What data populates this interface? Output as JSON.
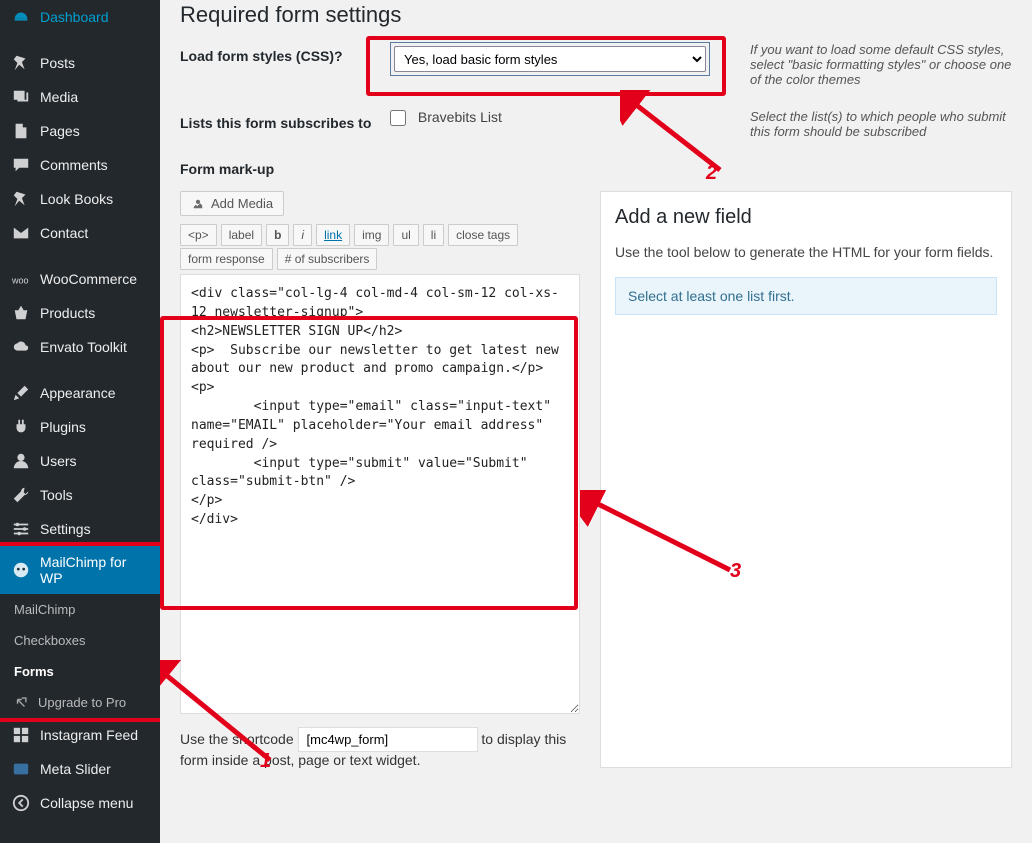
{
  "sidebar": {
    "items": [
      {
        "icon": "dashboard",
        "label": "Dashboard"
      },
      {
        "icon": "pin",
        "label": "Posts"
      },
      {
        "icon": "media",
        "label": "Media"
      },
      {
        "icon": "page",
        "label": "Pages"
      },
      {
        "icon": "comment",
        "label": "Comments"
      },
      {
        "icon": "pin",
        "label": "Look Books"
      },
      {
        "icon": "mail",
        "label": "Contact"
      },
      {
        "icon": "cart",
        "label": "WooCommerce"
      },
      {
        "icon": "basket",
        "label": "Products"
      },
      {
        "icon": "cloud",
        "label": "Envato Toolkit"
      },
      {
        "icon": "brush",
        "label": "Appearance"
      },
      {
        "icon": "plug",
        "label": "Plugins"
      },
      {
        "icon": "user",
        "label": "Users"
      },
      {
        "icon": "wrench",
        "label": "Tools"
      },
      {
        "icon": "sliders",
        "label": "Settings"
      },
      {
        "icon": "monkey",
        "label": "MailChimp for WP",
        "active": true
      },
      {
        "sub": true,
        "label": "MailChimp"
      },
      {
        "sub": true,
        "label": "Checkboxes"
      },
      {
        "sub": true,
        "label": "Forms",
        "activeSub": true
      },
      {
        "sub": true,
        "label": "Upgrade to Pro",
        "ext": true
      },
      {
        "icon": "grid",
        "label": "Instagram Feed"
      },
      {
        "icon": "slider",
        "label": "Meta Slider"
      },
      {
        "icon": "collapse",
        "label": "Collapse menu"
      }
    ]
  },
  "page": {
    "title": "Required form settings",
    "load_styles_label": "Load form styles (CSS)?",
    "load_styles_selected": "Yes, load basic form styles",
    "load_styles_help": "If you want to load some default CSS styles, select \"basic formatting styles\" or choose one of the color themes",
    "lists_label": "Lists this form subscribes to",
    "lists_checkbox": "Bravebits List",
    "lists_help": "Select the list(s) to which people who submit this form should be subscribed",
    "markup_label": "Form mark-up",
    "add_media": "Add Media",
    "qt": [
      "<p>",
      "label",
      "b",
      "i",
      "link",
      "img",
      "ul",
      "li",
      "close tags"
    ],
    "qt2": [
      "form response",
      "# of subscribers"
    ],
    "textarea": "<div class=\"col-lg-4 col-md-4 col-sm-12 col-xs-12 newsletter-signup\">\n<h2>NEWSLETTER SIGN UP</h2>\n<p>  Subscribe our newsletter to get latest new about our new product and promo campaign.</p>\n<p>\n        <input type=\"email\" class=\"input-text\" name=\"EMAIL\" placeholder=\"Your email address\" required />\n        <input type=\"submit\" value=\"Submit\" class=\"submit-btn\" />\n</p>\n</div>",
    "shortcode_pre": "Use the shortcode",
    "shortcode_val": "[mc4wp_form]",
    "shortcode_post": "to display this form inside a post, page or text widget.",
    "newfield_title": "Add a new field",
    "newfield_desc": "Use the tool below to generate the HTML for your form fields.",
    "newfield_info": "Select at least one list first."
  },
  "annotations": {
    "n1": "1",
    "n2": "2",
    "n3": "3"
  }
}
